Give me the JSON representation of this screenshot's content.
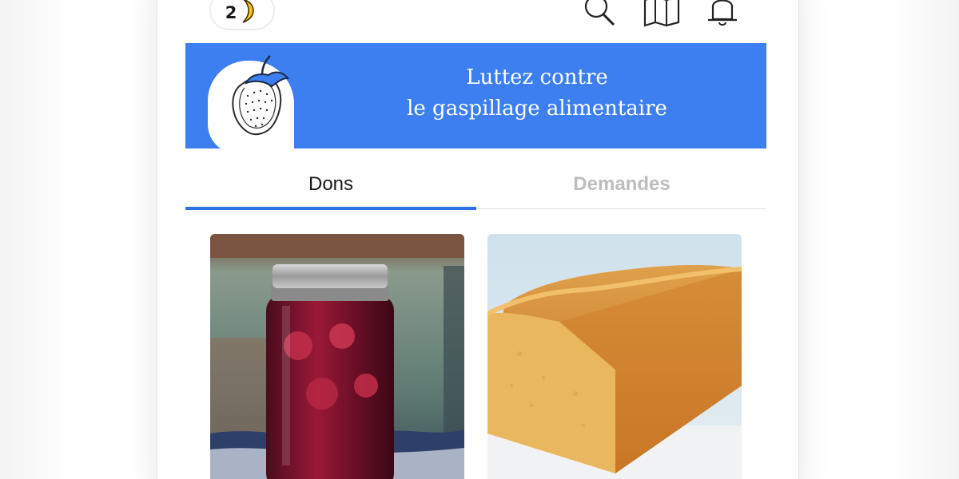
{
  "header": {
    "badge_count": "2",
    "icons": [
      "banana-icon",
      "search-icon",
      "map-icon",
      "bell-icon"
    ]
  },
  "banner": {
    "line1": "Luttez contre",
    "line2": "le gaspillage alimentaire",
    "icon": "strawberry-icon",
    "color": "#3d7ff0"
  },
  "tabs": [
    {
      "label": "Dons",
      "active": true
    },
    {
      "label": "Demandes",
      "active": false
    }
  ],
  "colors": {
    "accent": "#2f72e6",
    "inactive_tab": "#bdbdbd"
  },
  "listings": [
    {
      "image": "jam-jar-photo"
    },
    {
      "image": "loaf-cake-photo"
    }
  ]
}
